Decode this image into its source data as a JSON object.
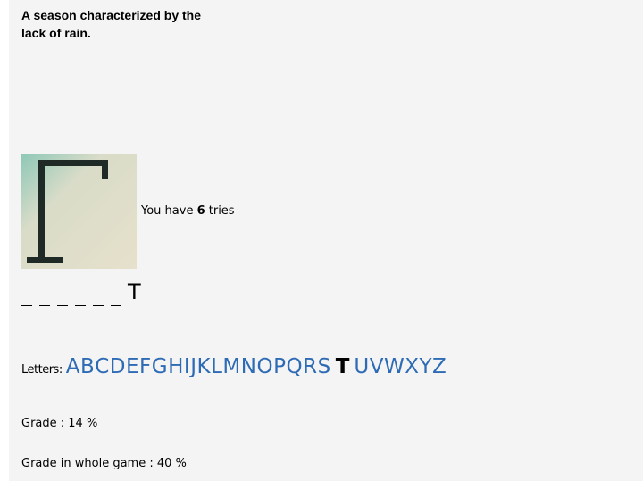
{
  "question": {
    "line1": "A season characterized by the",
    "line2": "lack of rain."
  },
  "gallows_icon": "gallows-image",
  "tries": {
    "prefix": "You have ",
    "count": "6",
    "suffix": " tries"
  },
  "word": {
    "slots": [
      "_",
      "_",
      "_",
      "_",
      "_",
      "_"
    ],
    "revealed_letter": "T"
  },
  "letters": {
    "label": "Letters:",
    "items": [
      "A",
      "B",
      "C",
      "D",
      "E",
      "F",
      "G",
      "H",
      "I",
      "J",
      "K",
      "L",
      "M",
      "N",
      "O",
      "P",
      "Q",
      "R",
      "S",
      "T",
      "U",
      "V",
      "W",
      "X",
      "Y",
      "Z"
    ],
    "used": [
      "T"
    ]
  },
  "grade": "Grade : 14 %",
  "grade_game": "Grade in whole game : 40 %",
  "colors": {
    "letter_link": "#2e6bb5",
    "panel_bg": "#f4f4f4"
  }
}
